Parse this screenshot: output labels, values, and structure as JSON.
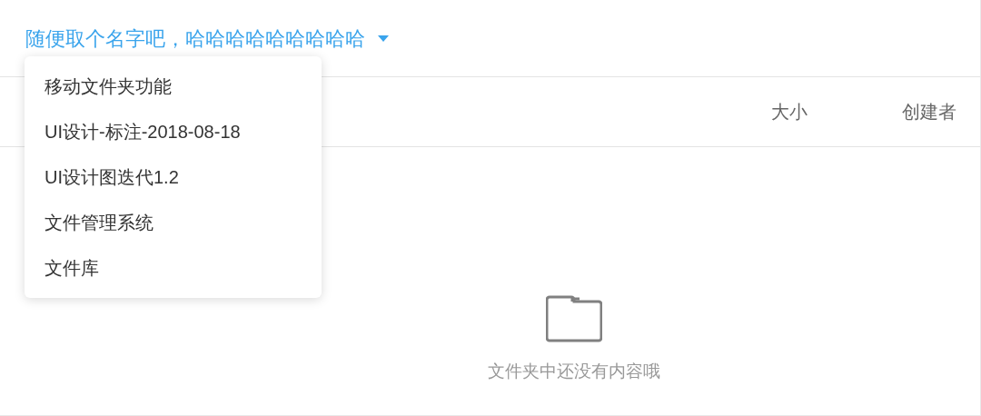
{
  "folder_title": {
    "label": "随便取个名字吧，哈哈哈哈哈哈哈哈哈",
    "expanded": true
  },
  "folder_menu": [
    {
      "label": "移动文件夹功能"
    },
    {
      "label": "UI设计-标注-2018-08-18"
    },
    {
      "label": "UI设计图迭代1.2"
    },
    {
      "label": "文件管理系统"
    },
    {
      "label": "文件库"
    }
  ],
  "table": {
    "columns": [
      "大小",
      "创建者"
    ]
  },
  "empty_state": {
    "message": "文件夹中还没有内容哦"
  }
}
